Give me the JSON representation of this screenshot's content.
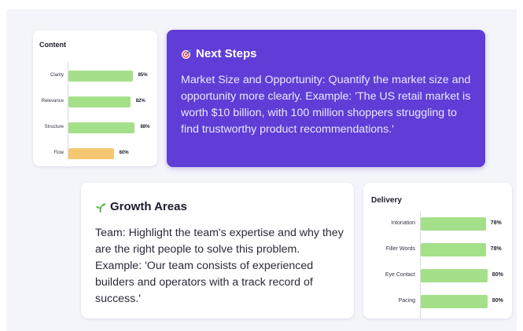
{
  "colors": {
    "accent": "#5f3dd6",
    "bar_green": "#a4e08a",
    "bar_orange": "#f6c772",
    "background": "#f4f4fb"
  },
  "content_chart": {
    "title": "Content",
    "chart_data": {
      "type": "bar",
      "orientation": "horizontal",
      "title": "Content",
      "categories": [
        "Clarity",
        "Relevance",
        "Structure",
        "Flow"
      ],
      "values": [
        85,
        82,
        88,
        60
      ],
      "value_labels": [
        "85%",
        "82%",
        "88%",
        "60%"
      ],
      "bar_colors": [
        "#a4e08a",
        "#a4e08a",
        "#a4e08a",
        "#f6c772"
      ],
      "xlim": [
        0,
        100
      ],
      "grid": false
    }
  },
  "next_steps": {
    "icon": "target-icon",
    "title": "Next Steps",
    "text": "Market Size and Opportunity: Quantify the market size and opportunity more clearly. Example: 'The US retail market is worth $10 billion, with 100 million shoppers struggling to find trustworthy product recommendations.'"
  },
  "growth_areas": {
    "icon": "seedling-icon",
    "title": "Growth Areas",
    "text": "Team: Highlight the team's expertise and why they are the right people to solve this problem. Example: 'Our team consists of experienced builders and operators with a track record of success.'"
  },
  "delivery_chart": {
    "title": "Delivery",
    "chart_data": {
      "type": "bar",
      "orientation": "horizontal",
      "title": "Delivery",
      "categories": [
        "Intonation",
        "Filler Words",
        "Eye Contact",
        "Pacing"
      ],
      "values": [
        78,
        78,
        80,
        80
      ],
      "value_labels": [
        "78%",
        "78%",
        "80%",
        "80%"
      ],
      "bar_colors": [
        "#a4e08a",
        "#a4e08a",
        "#a4e08a",
        "#a4e08a"
      ],
      "xlim": [
        0,
        100
      ],
      "grid": false
    }
  }
}
